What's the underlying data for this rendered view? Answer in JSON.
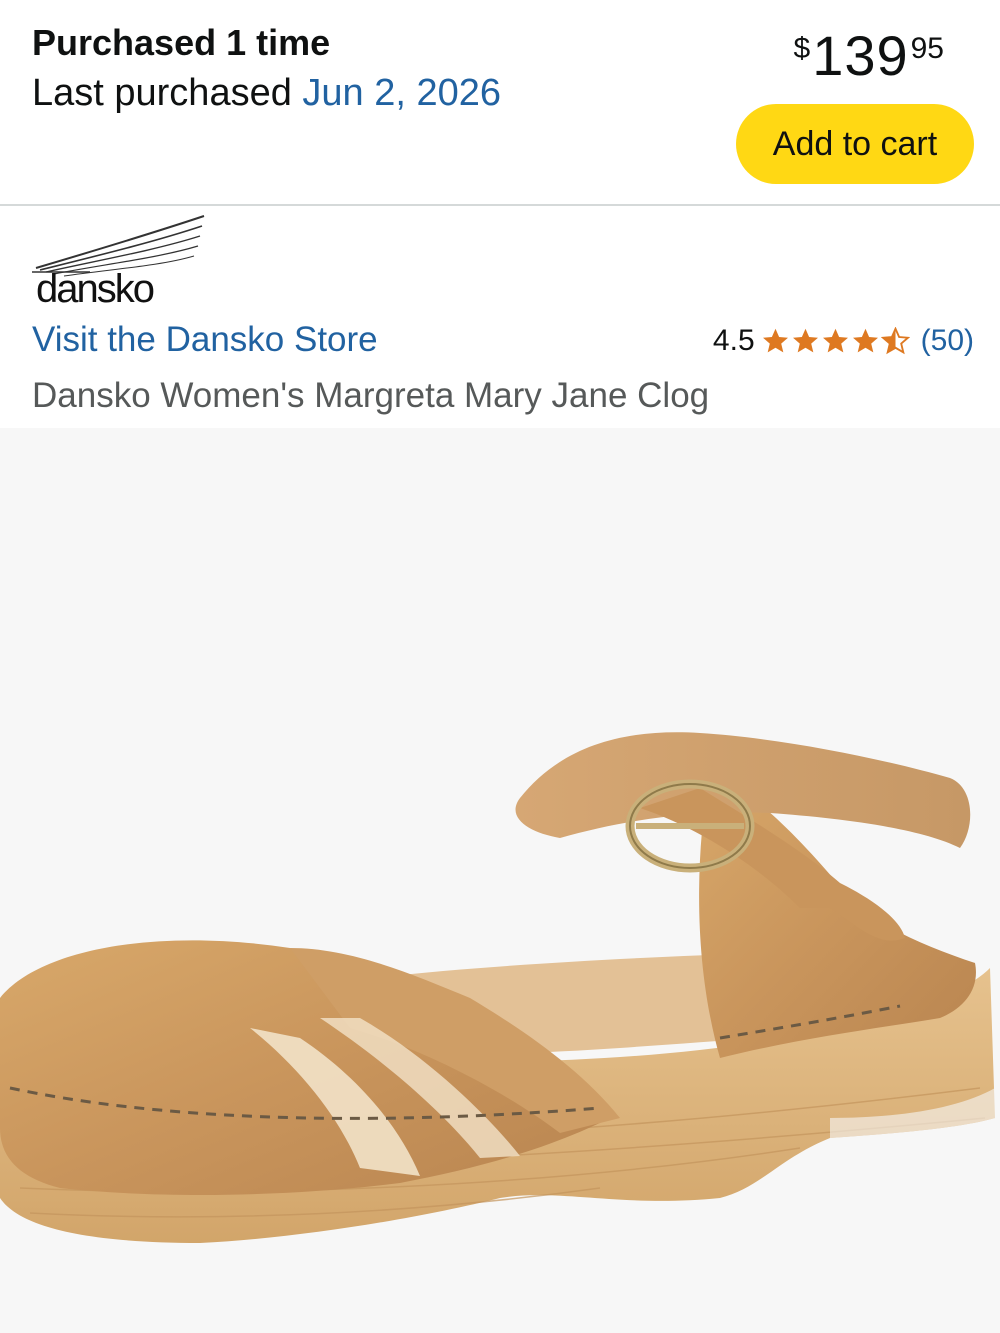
{
  "purchase": {
    "count_text": "Purchased 1 time",
    "last_label": "Last purchased",
    "last_date": "Jun 2, 2026"
  },
  "price": {
    "symbol": "$",
    "whole": "139",
    "fraction": "95"
  },
  "actions": {
    "add_to_cart": "Add to cart"
  },
  "brand": {
    "logo_text": "dansko",
    "store_link": "Visit the Dansko Store"
  },
  "rating": {
    "value": "4.5",
    "stars": 4.5,
    "count": "(50)"
  },
  "product": {
    "title": "Dansko Women's Margreta Mary Jane Clog",
    "image_icon": "sandal-clog-image"
  },
  "colors": {
    "link": "#2162a1",
    "cart_button": "#ffd814",
    "star": "#de7921",
    "image_bg": "#f7f7f7"
  }
}
